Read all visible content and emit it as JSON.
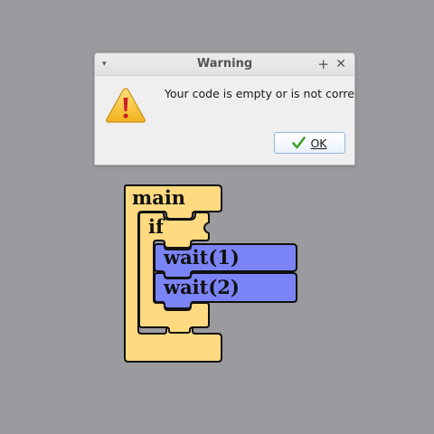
{
  "dialog": {
    "title": "Warning",
    "message": "Your code is empty or is not correct",
    "ok_label": "OK",
    "menu_glyph": "▾",
    "pin_glyph": "+",
    "close_glyph": "✕"
  },
  "blocks": {
    "main_label": "main",
    "if_label": "if",
    "statements": [
      "wait(1)",
      "wait(2)"
    ],
    "colors": {
      "control": "#ffda80",
      "statement": "#7b84f6",
      "outline": "#111111"
    }
  },
  "icons": {
    "dialog_menu": "chevron-down-icon",
    "dialog_pin": "pin-icon",
    "dialog_close": "close-icon",
    "warning": "warning-triangle-icon",
    "ok": "checkmark-icon"
  }
}
